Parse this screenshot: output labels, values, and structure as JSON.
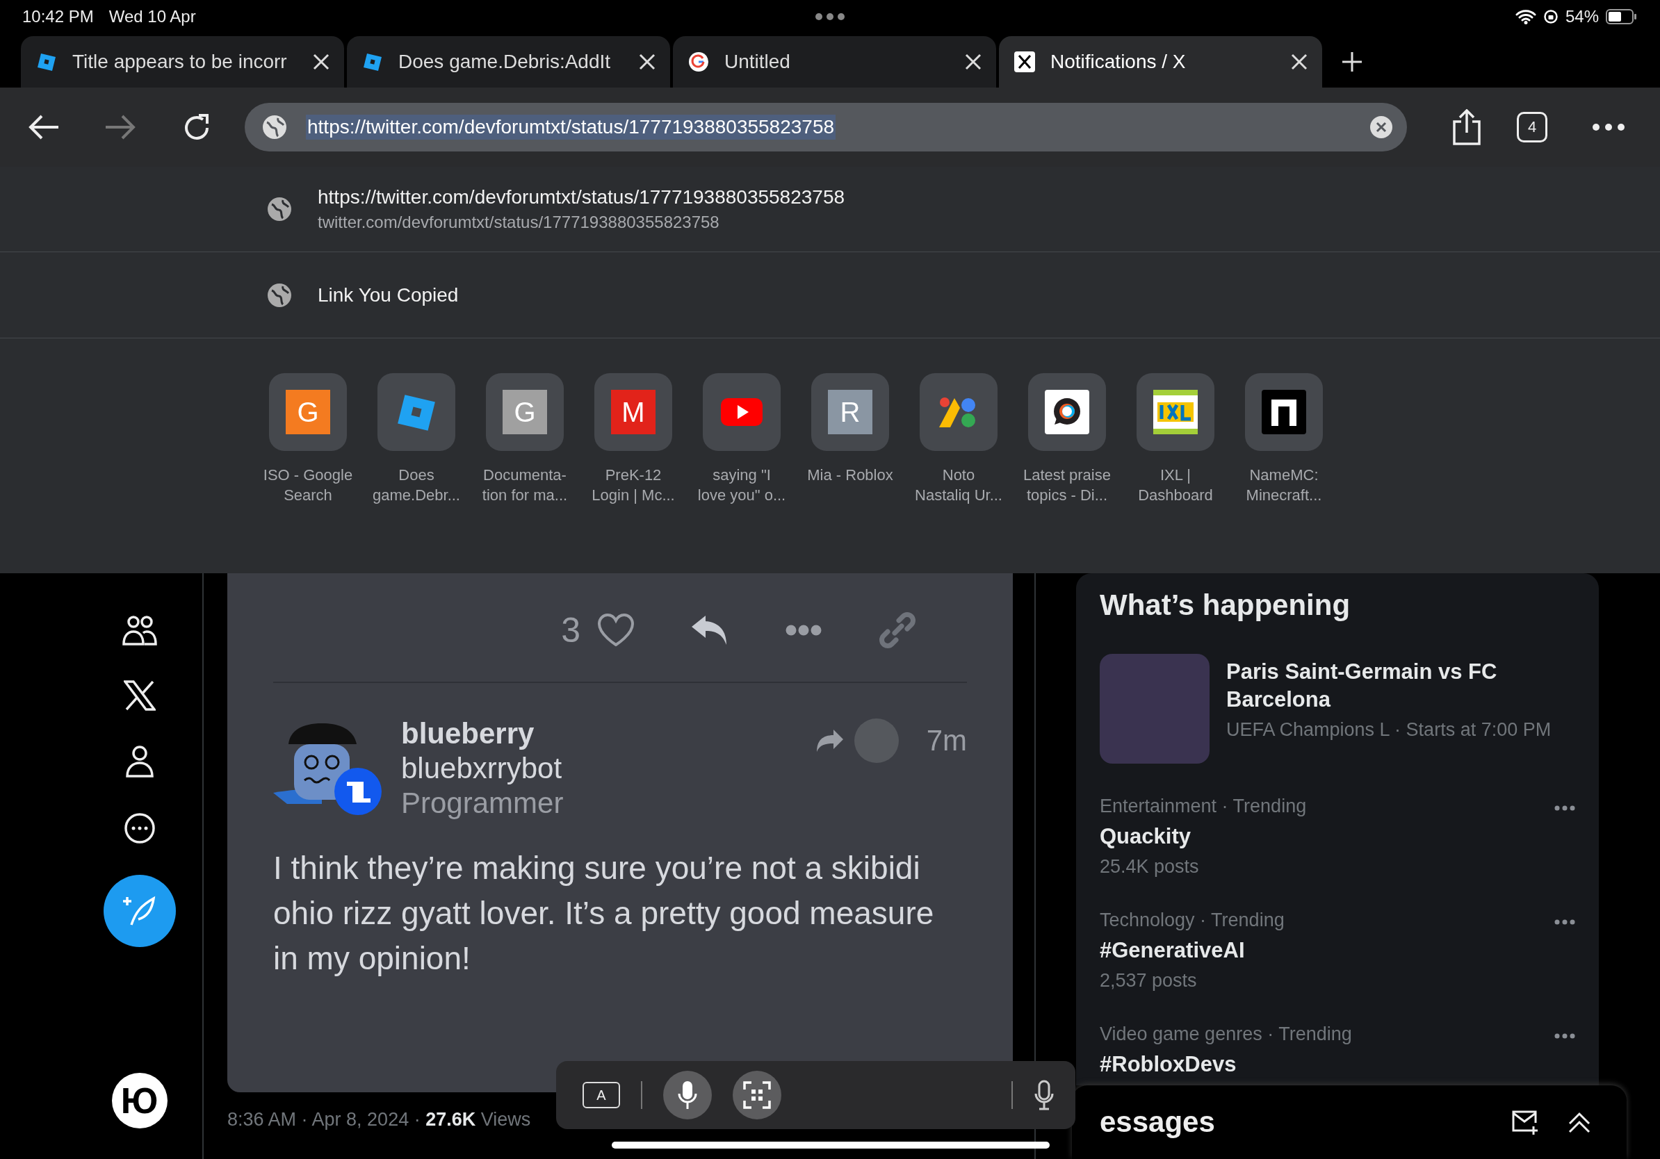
{
  "status_bar": {
    "time": "10:42 PM",
    "date": "Wed 10 Apr",
    "battery": "54%"
  },
  "tabs": [
    {
      "title": "Title appears to be incorr",
      "kind": "roblox",
      "selected": false
    },
    {
      "title": "Does game.Debris:AddIt",
      "kind": "roblox",
      "selected": false
    },
    {
      "title": "Untitled",
      "kind": "google",
      "selected": false
    },
    {
      "title": "Notifications / X",
      "kind": "x",
      "selected": true
    }
  ],
  "toolbar": {
    "url": "https://twitter.com/devforumtxt/status/1777193880355823758",
    "tab_count": "4"
  },
  "suggestions": [
    {
      "kind": "url",
      "title": "https://twitter.com/devforumtxt/status/1777193880355823758",
      "subtitle": "twitter.com/devforumtxt/status/1777193880355823758"
    },
    {
      "kind": "clipboard",
      "title": "Link You Copied"
    }
  ],
  "favorites": [
    {
      "kind": "letter",
      "letter": "G",
      "color": "#f47b20",
      "label_lines": [
        "ISO - Google",
        "Search"
      ]
    },
    {
      "kind": "roblox",
      "label_lines": [
        "Does",
        "game.Debr..."
      ]
    },
    {
      "kind": "letter",
      "letter": "G",
      "color": "#a0a0a0",
      "label_lines": [
        "Documenta-",
        "tion for ma..."
      ]
    },
    {
      "kind": "letter",
      "letter": "M",
      "color": "#e2231a",
      "label_lines": [
        "PreK-12",
        "Login | Mc..."
      ]
    },
    {
      "kind": "youtube",
      "label_lines": [
        "saying \"I",
        "love you\" o..."
      ]
    },
    {
      "kind": "letter",
      "letter": "R",
      "color": "#8a96a3",
      "label_lines": [
        "Mia - Roblox"
      ]
    },
    {
      "kind": "noto",
      "label_lines": [
        "Noto",
        "Nastaliq Ur..."
      ]
    },
    {
      "kind": "discourse",
      "label_lines": [
        "Latest praise",
        "topics - Di..."
      ]
    },
    {
      "kind": "ixl",
      "label_lines": [
        "IXL |",
        "Dashboard"
      ]
    },
    {
      "kind": "namemc",
      "label_lines": [
        "NameMC:",
        "Minecraft..."
      ]
    }
  ],
  "sidebar": {
    "logo": "Ю"
  },
  "post_card": {
    "like_count": "3",
    "reply": {
      "name": "blueberry",
      "username": "bluebxrrybot",
      "role": "Programmer",
      "time": "7m",
      "text": "I think they’re making sure you’re not a skibidi ohio rizz gyatt lover. It’s a pretty good measure in my opinion!"
    }
  },
  "post_meta": "8:36 AM · Apr 8, 2024 · **27.6K** Views",
  "trends": {
    "title": "What’s happening",
    "event": {
      "title": "Paris Saint-Germain vs FC Barcelona",
      "subtitle": "UEFA Champions L · Starts at 7:00 PM"
    },
    "items": [
      {
        "context": "Entertainment · Trending",
        "name": "Quackity",
        "count": "25.4K posts"
      },
      {
        "context": "Technology · Trending",
        "name": "#GenerativeAI",
        "count": "2,537 posts"
      },
      {
        "context": "Video game genres · Trending",
        "name": "#RobloxDevs"
      }
    ]
  },
  "messages_bar": {
    "title": "essages"
  },
  "keyboard_bar": {
    "text_key": "A"
  }
}
